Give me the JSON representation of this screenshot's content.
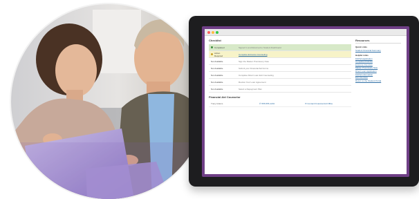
{
  "browser": {
    "window_controls": [
      "close",
      "minimize",
      "zoom"
    ]
  },
  "checklist": {
    "title": "Checklist",
    "items": [
      {
        "status": "Completed",
        "description": "Signed In and Returned to Student Dashboard",
        "state": "done"
      },
      {
        "status": "Action Required",
        "description": "Complete Entrance Counseling",
        "state": "next"
      },
      {
        "status": "Not Available",
        "description": "Sign the Master Promissory Note",
        "state": "locked"
      },
      {
        "status": "Not Available",
        "description": "Submit your Financial Aid Forms",
        "state": "locked"
      },
      {
        "status": "Not Available",
        "description": "Complete Direct Loan Exit Counseling",
        "state": "locked"
      },
      {
        "status": "Not Available",
        "description": "Review Your Loan Agreement",
        "state": "locked"
      },
      {
        "status": "Not Available",
        "description": "Select a Repayment Plan",
        "state": "locked"
      }
    ]
  },
  "counselor": {
    "title": "Financial Aid Counselor",
    "name": "Tracy Adams",
    "phone": "555-555-1234",
    "email_label": "Contact Financial Aid Office"
  },
  "resources": {
    "title": "Resources",
    "groups": [
      {
        "label": "Quick Links",
        "links": [
          "Student Financial Summary"
        ]
      },
      {
        "label": "Helpful Links",
        "links": [
          "FAFSA Application",
          "Completed FAFSA",
          "Entrance Interview",
          "Master Promissory Note",
          "Direct Loan Application",
          "FAFSA Information",
          "Exit Interview",
          "Return to the Student Portal"
        ]
      }
    ]
  },
  "colors": {
    "frame": "#6f3f86",
    "done": "#d7e9c8",
    "next": "#f7f3c8",
    "link": "#2d6ea5"
  }
}
